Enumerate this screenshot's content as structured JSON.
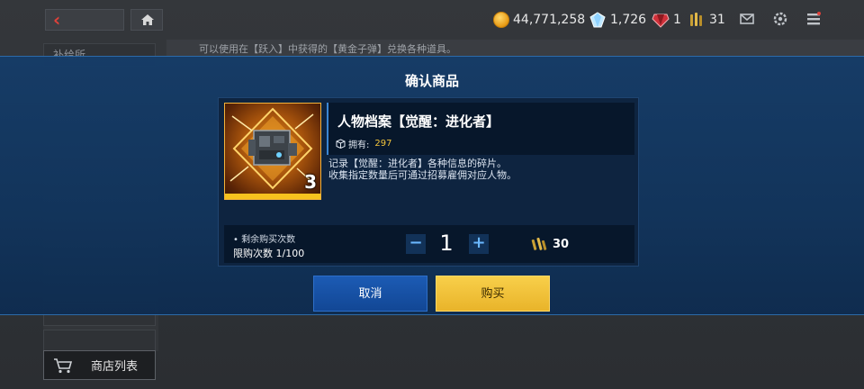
{
  "top_bar": {
    "gold": "44,771,258",
    "diamonds": "1,726",
    "rubies": "1",
    "bullets": "31"
  },
  "background": {
    "notice": "可以使用在【跃入】中获得的【黄金子弹】兑换各种道具。",
    "side_items": [
      "补给所",
      "",
      "",
      ""
    ],
    "shop_list_label": "商店列表"
  },
  "modal": {
    "title": "确认商品",
    "item": {
      "name": "人物档案【觉醒：进化者】",
      "owned_label": "拥有:",
      "owned_value": "297",
      "count": "3",
      "description": [
        "记录【觉醒：进化者】各种信息的碎片。",
        "收集指定数量后可通过招募雇佣对应人物。"
      ]
    },
    "purchase": {
      "remaining_label": "• 剩余购买次数",
      "limit_label": "限购次数  1/100",
      "minus": "−",
      "plus": "+",
      "quantity": "1",
      "price": "30"
    },
    "buttons": {
      "cancel": "取消",
      "buy": "购买"
    }
  },
  "colors": {
    "accent_blue": "#1c5bb4",
    "accent_gold": "#f8cf4a",
    "modal_bg": "#153c68"
  }
}
